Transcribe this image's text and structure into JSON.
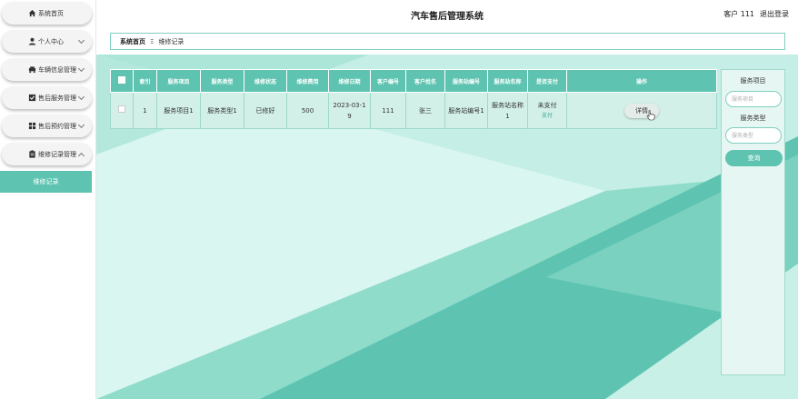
{
  "header": {
    "title": "汽车售后管理系统",
    "user": "客户 111",
    "logout": "退出登录"
  },
  "sidebar": {
    "items": [
      {
        "label": "系统首页",
        "icon": "home-icon"
      },
      {
        "label": "个人中心",
        "icon": "user-icon"
      },
      {
        "label": "车辆信息管理",
        "icon": "car-icon"
      },
      {
        "label": "售后服务管理",
        "icon": "checklist-icon"
      },
      {
        "label": "售后预约管理",
        "icon": "grid-icon"
      },
      {
        "label": "维修记录管理",
        "icon": "clipboard-icon"
      }
    ],
    "sub_item": "维修记录"
  },
  "breadcrumb": {
    "home": "系统首页",
    "separator": "Ξ",
    "current": "维修记录"
  },
  "table": {
    "headers": [
      "索引",
      "服务项目",
      "服务类型",
      "维修状态",
      "维修费用",
      "维修日期",
      "客户编号",
      "客户姓名",
      "服务站编号",
      "服务站名称",
      "是否支付",
      "操作"
    ],
    "rows": [
      {
        "index": "1",
        "service_item": "服务项目1",
        "service_type": "服务类型1",
        "status": "已修好",
        "fee": "500",
        "date": "2023-03-19",
        "customer_no": "111",
        "customer_name": "张三",
        "station_no": "服务站编号1",
        "station_name": "服务站名称1",
        "paid": "未支付",
        "pay_link": "支付",
        "action": "详情"
      }
    ]
  },
  "search": {
    "label_item": "服务项目",
    "placeholder_item": "服务项目",
    "label_type": "服务类型",
    "placeholder_type": "服务类型",
    "button": "查询"
  },
  "colors": {
    "accent": "#5ec4b1",
    "row_bg": "#d2efe8",
    "panel_bg": "#e6f7f3"
  }
}
